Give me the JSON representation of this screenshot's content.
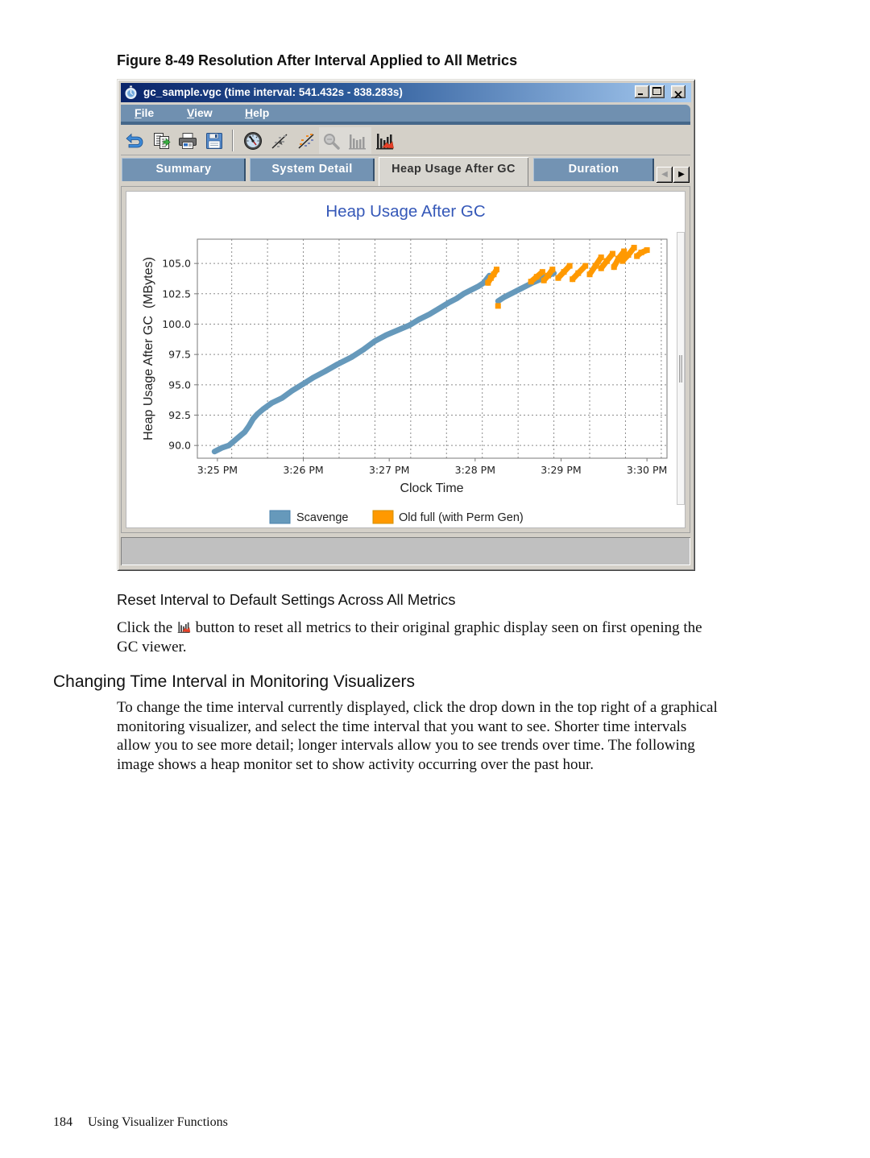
{
  "figure_caption": "Figure 8-49 Resolution After Interval Applied to All Metrics",
  "window": {
    "title": "gc_sample.vgc (time interval: 541.432s - 838.283s)",
    "app_icon": "stopwatch-icon",
    "controls": [
      {
        "icon": "minimize-icon"
      },
      {
        "icon": "maximize-icon"
      },
      {
        "icon": "close-icon"
      }
    ],
    "menu": [
      {
        "label": "File"
      },
      {
        "label": "View"
      },
      {
        "label": "Help"
      }
    ],
    "toolbar": [
      {
        "icon": "undo-icon",
        "enabled": true
      },
      {
        "icon": "export-icon",
        "enabled": true
      },
      {
        "icon": "print-icon",
        "enabled": true
      },
      {
        "icon": "save-icon",
        "enabled": true
      },
      {
        "icon": "gauge-icon",
        "enabled": true
      },
      {
        "icon": "scatter-zoom-icon",
        "enabled": true
      },
      {
        "icon": "scatter-color-icon",
        "enabled": true
      },
      {
        "icon": "magnifier-icon",
        "enabled": false
      },
      {
        "icon": "bar-chart-icon",
        "enabled": false
      },
      {
        "icon": "reset-metrics-icon",
        "enabled": true
      }
    ],
    "tabs": [
      {
        "label": "Summary",
        "active": false
      },
      {
        "label": "System Detail",
        "active": false
      },
      {
        "label": "Heap Usage After GC",
        "active": true
      },
      {
        "label": "Duration",
        "active": false
      }
    ],
    "tab_scroll": {
      "left_glyph": "◀",
      "right_glyph": "▶",
      "left_enabled": false,
      "right_enabled": true
    },
    "colors": {
      "titlebar_start": "#0a246a",
      "titlebar_end": "#a6caf0",
      "menubar": "#7090b0",
      "tab": "#7393b3",
      "chart_title": "#3558b8"
    }
  },
  "chart_data": {
    "type": "scatter",
    "title": "Heap Usage After GC",
    "xlabel": "Clock Time",
    "ylabel": "Heap Usage After GC  (MBytes)",
    "xlim": [
      "3:24:46",
      "3:30:14"
    ],
    "ylim": [
      88.95,
      107.0
    ],
    "x_ticks": [
      {
        "label": "3:25 PM",
        "time": "3:25:00"
      },
      {
        "label": "3:26 PM",
        "time": "3:26:00"
      },
      {
        "label": "3:27 PM",
        "time": "3:27:00"
      },
      {
        "label": "3:28 PM",
        "time": "3:28:00"
      },
      {
        "label": "3:29 PM",
        "time": "3:29:00"
      },
      {
        "label": "3:30 PM",
        "time": "3:30:00"
      }
    ],
    "y_ticks": [
      "90.0",
      "92.5",
      "95.0",
      "97.5",
      "100.0",
      "102.5",
      "105.0"
    ],
    "x_grid": {
      "start": "3:25:10",
      "step_seconds": 25
    },
    "grid": true,
    "legend": "bottom",
    "series": [
      {
        "name": "Scavenge",
        "color": "#6699bb",
        "segments": [
          [
            [
              "3:24:58",
              89.5
            ],
            [
              "3:25:03",
              89.8
            ],
            [
              "3:25:08",
              90.0
            ],
            [
              "3:25:12",
              90.4
            ],
            [
              "3:25:16",
              90.8
            ],
            [
              "3:25:19",
              91.1
            ],
            [
              "3:25:22",
              91.6
            ],
            [
              "3:25:25",
              92.2
            ],
            [
              "3:25:28",
              92.6
            ],
            [
              "3:25:32",
              93.0
            ],
            [
              "3:25:38",
              93.5
            ],
            [
              "3:25:45",
              93.9
            ],
            [
              "3:25:52",
              94.5
            ],
            [
              "3:25:59",
              95.0
            ],
            [
              "3:26:07",
              95.6
            ],
            [
              "3:26:15",
              96.1
            ],
            [
              "3:26:24",
              96.7
            ],
            [
              "3:26:34",
              97.3
            ],
            [
              "3:26:42",
              97.9
            ],
            [
              "3:26:50",
              98.6
            ],
            [
              "3:26:58",
              99.1
            ],
            [
              "3:27:06",
              99.5
            ],
            [
              "3:27:14",
              99.9
            ],
            [
              "3:27:21",
              100.4
            ],
            [
              "3:27:28",
              100.8
            ],
            [
              "3:27:35",
              101.3
            ],
            [
              "3:27:42",
              101.8
            ],
            [
              "3:27:47",
              102.1
            ],
            [
              "3:27:52",
              102.5
            ],
            [
              "3:27:57",
              102.8
            ],
            [
              "3:28:02",
              103.1
            ],
            [
              "3:28:06",
              103.4
            ],
            [
              "3:28:10",
              104.0
            ]
          ],
          [
            [
              "3:28:16",
              101.9
            ],
            [
              "3:28:20",
              102.2
            ],
            [
              "3:28:25",
              102.5
            ],
            [
              "3:28:30",
              102.8
            ],
            [
              "3:28:35",
              103.1
            ],
            [
              "3:28:40",
              103.4
            ],
            [
              "3:28:46",
              103.7
            ],
            [
              "3:28:51",
              104.0
            ],
            [
              "3:28:55",
              104.2
            ]
          ]
        ]
      },
      {
        "name": "Old full (with Perm Gen)",
        "color": "#ff9900",
        "segments": [
          [
            [
              "3:28:09",
              103.4
            ],
            [
              "3:28:11",
              103.8
            ],
            [
              "3:28:13",
              104.1
            ],
            [
              "3:28:15",
              104.5
            ]
          ],
          [
            [
              "3:28:16",
              101.5
            ]
          ],
          [
            [
              "3:28:39",
              103.5
            ],
            [
              "3:28:43",
              103.9
            ],
            [
              "3:28:47",
              104.3
            ]
          ],
          [
            [
              "3:28:48",
              103.6
            ],
            [
              "3:28:51",
              104.0
            ],
            [
              "3:28:54",
              104.5
            ]
          ],
          [
            [
              "3:28:58",
              103.8
            ],
            [
              "3:29:02",
              104.3
            ],
            [
              "3:29:06",
              104.8
            ]
          ],
          [
            [
              "3:29:08",
              103.7
            ],
            [
              "3:29:12",
              104.2
            ],
            [
              "3:29:17",
              104.8
            ]
          ],
          [
            [
              "3:29:20",
              104.1
            ],
            [
              "3:29:24",
              104.8
            ],
            [
              "3:29:28",
              105.5
            ]
          ],
          [
            [
              "3:29:28",
              104.6
            ],
            [
              "3:29:32",
              105.2
            ],
            [
              "3:29:36",
              105.8
            ]
          ],
          [
            [
              "3:29:37",
              104.7
            ],
            [
              "3:29:40",
              105.4
            ],
            [
              "3:29:44",
              106.0
            ]
          ],
          [
            [
              "3:29:43",
              105.2
            ],
            [
              "3:29:47",
              105.7
            ],
            [
              "3:29:51",
              106.3
            ]
          ],
          [
            [
              "3:29:53",
              105.6
            ],
            [
              "3:29:56",
              105.9
            ],
            [
              "3:30:00",
              106.1
            ]
          ]
        ]
      }
    ]
  },
  "document": {
    "subheading": "Reset Interval to Default Settings Across All Metrics",
    "reset_paragraph": {
      "before_icon": "Click the ",
      "icon": "reset-metrics-icon",
      "after_icon": " button to reset all metrics to their original graphic display seen on first opening the",
      "lines_after": [
        "GC viewer."
      ]
    },
    "section_heading": "Changing Time Interval in Monitoring Visualizers",
    "section_paragraph_lines": [
      "To change the time interval currently displayed, click the drop down in the top right of a graphical",
      "monitoring visualizer, and select the time interval that you want to see. Shorter time intervals",
      "allow you to see more detail; longer intervals allow you to see trends over time. The following",
      "image shows a heap monitor set to show activity occurring over the past hour."
    ]
  },
  "footer": {
    "page_number": "184",
    "section_title": "Using Visualizer Functions"
  }
}
